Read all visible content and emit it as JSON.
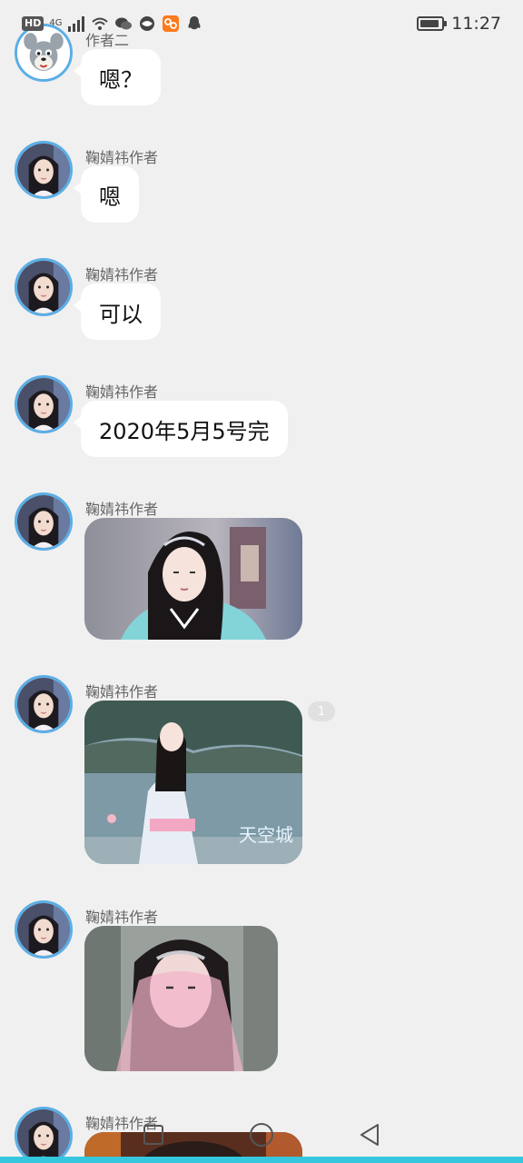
{
  "status_bar": {
    "hd_badge": "HD",
    "network": "4G",
    "time": "11:27",
    "battery_level": 0.9,
    "icons": [
      "signal-icon",
      "wifi-icon",
      "wechat-icon",
      "browser-icon",
      "app-icon",
      "qq-icon",
      "battery-icon"
    ]
  },
  "messages": [
    {
      "sender": "作者二",
      "type": "text",
      "text": "嗯？",
      "avatar": "cartoon-cat-avatar"
    },
    {
      "sender": "鞠婧祎作者",
      "type": "text",
      "text": "嗯",
      "avatar": "woman-avatar"
    },
    {
      "sender": "鞠婧祎作者",
      "type": "text",
      "text": "可以",
      "avatar": "woman-avatar"
    },
    {
      "sender": "鞠婧祎作者",
      "type": "text",
      "text": "2020年5月5号完",
      "avatar": "woman-avatar"
    },
    {
      "sender": "鞠婧祎作者",
      "type": "image",
      "image": "woman-in-teal-hanfu-photo",
      "avatar": "woman-avatar"
    },
    {
      "sender": "鞠婧祎作者",
      "type": "image",
      "image": "woman-by-lake-photo",
      "image_caption": "天空城",
      "badge": "1",
      "avatar": "woman-avatar"
    },
    {
      "sender": "鞠婧祎作者",
      "type": "image",
      "image": "woman-with-pink-veil-photo",
      "avatar": "woman-avatar"
    },
    {
      "sender": "鞠婧祎作者",
      "type": "image",
      "image": "partial-photo",
      "avatar": "woman-avatar"
    }
  ],
  "nav_bar": {
    "buttons": [
      "recent-apps-icon",
      "home-icon",
      "back-icon"
    ]
  },
  "colors": {
    "background": "#f0f0f0",
    "avatar_border": "#5aaee6",
    "bottom_accent": "#35c7dd",
    "bubble": "#ffffff"
  }
}
